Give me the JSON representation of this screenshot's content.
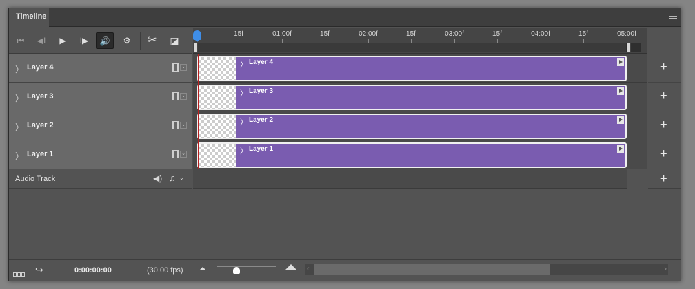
{
  "panel": {
    "tab_title": "Timeline"
  },
  "controls": {
    "first_frame": "⏮",
    "prev_frame": "◀I",
    "play": "▶",
    "next_frame": "I▶",
    "audio": "🔊",
    "settings": "⚙",
    "split": "✂",
    "transition": "◪"
  },
  "ruler": {
    "ticks": [
      "15f",
      "01:00f",
      "15f",
      "02:00f",
      "15f",
      "03:00f",
      "15f",
      "04:00f",
      "15f",
      "05:00f"
    ]
  },
  "layers": [
    {
      "name": "Layer 4",
      "clip_name": "Layer 4"
    },
    {
      "name": "Layer 3",
      "clip_name": "Layer 3"
    },
    {
      "name": "Layer 2",
      "clip_name": "Layer 2"
    },
    {
      "name": "Layer 1",
      "clip_name": "Layer 1"
    }
  ],
  "audio_track": {
    "name": "Audio Track"
  },
  "footer": {
    "current_time": "0:00:00:00",
    "fps": "(30.00 fps)"
  },
  "icons": {
    "chevron": "〉",
    "add": "+",
    "speaker": "◀)",
    "music": "♫",
    "dropdown": "⌄",
    "convert": "↪",
    "scroll_left": "‹",
    "scroll_right": "›"
  }
}
